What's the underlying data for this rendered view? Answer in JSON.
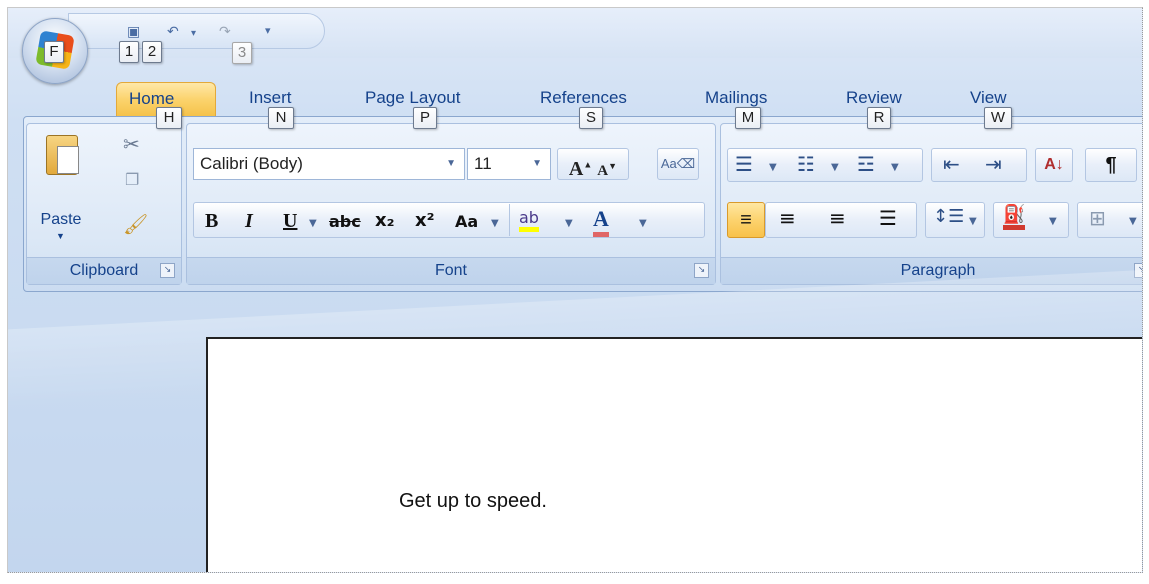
{
  "office_button": {
    "keytip": "F"
  },
  "qat": {
    "items": [
      {
        "icon": "save-icon",
        "keytip": "1"
      },
      {
        "icon": "undo-icon",
        "keytip": "2"
      },
      {
        "icon": "redo-icon",
        "keytip": "3"
      }
    ],
    "customize_icon": "qat-customize-icon"
  },
  "tabs": [
    {
      "label": "Home",
      "keytip": "H",
      "active": true
    },
    {
      "label": "Insert",
      "keytip": "N"
    },
    {
      "label": "Page Layout",
      "keytip": "P"
    },
    {
      "label": "References",
      "keytip": "S"
    },
    {
      "label": "Mailings",
      "keytip": "M"
    },
    {
      "label": "Review",
      "keytip": "R"
    },
    {
      "label": "View",
      "keytip": "W"
    }
  ],
  "groups": {
    "clipboard": {
      "label": "Clipboard",
      "paste_label": "Paste"
    },
    "font": {
      "label": "Font",
      "font_name": "Calibri (Body)",
      "font_size": "11",
      "bold": "B",
      "italic": "I",
      "underline": "U",
      "strike": "abc",
      "subscript": "x₂",
      "superscript": "x²",
      "change_case": "Aa",
      "grow": "A",
      "shrink": "A",
      "highlight": "ab",
      "font_color": "A",
      "clear": "Aa"
    },
    "paragraph": {
      "label": "Paragraph",
      "show_marks": "¶",
      "sort": "A↓"
    }
  },
  "document": {
    "text": "Get up to speed."
  },
  "colors": {
    "accent": "#fbd36d",
    "ribbon": "#dce8f6",
    "text": "#15428b"
  }
}
